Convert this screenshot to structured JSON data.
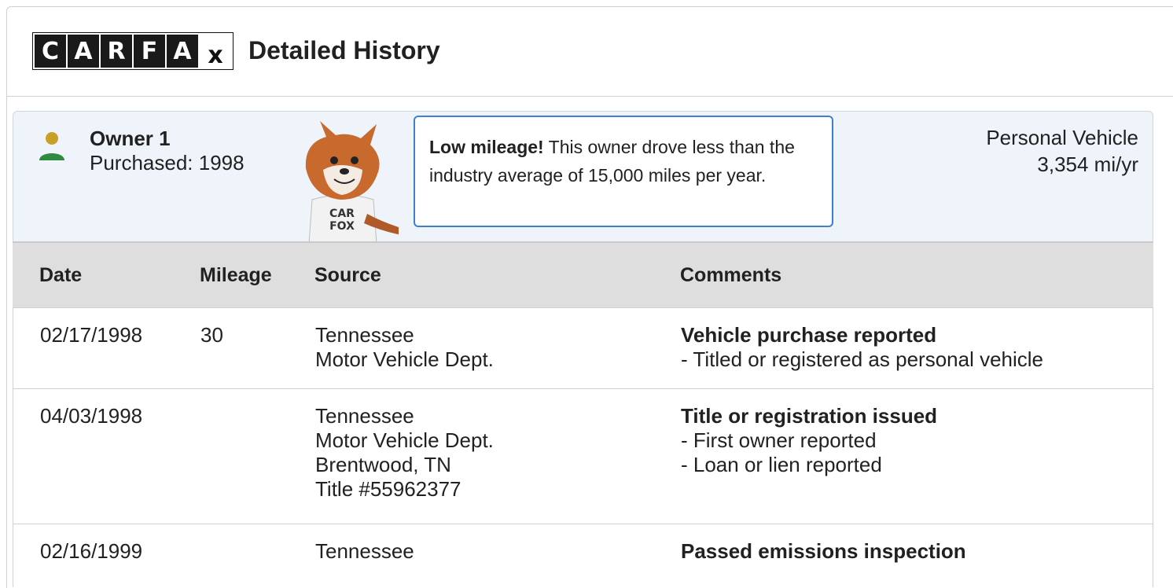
{
  "header": {
    "logo_letters": [
      "C",
      "A",
      "R",
      "F",
      "A",
      "x"
    ],
    "title": "Detailed History"
  },
  "owner": {
    "name": "Owner 1",
    "purchased": "Purchased: 1998",
    "fox_shirt_text": [
      "CAR",
      "FOX"
    ],
    "callout_bold": "Low mileage!",
    "callout_text": " This owner drove less than the industry average of 15,000 miles per year.",
    "usage_type": "Personal Vehicle",
    "usage_rate": "3,354 mi/yr"
  },
  "table": {
    "columns": {
      "date": "Date",
      "mileage": "Mileage",
      "source": "Source",
      "comments": "Comments"
    },
    "rows": [
      {
        "date": "02/17/1998",
        "mileage": "30",
        "source": [
          "Tennessee",
          "Motor Vehicle Dept."
        ],
        "comment_title": "Vehicle purchase reported",
        "comment_lines": [
          "- Titled or registered as personal vehicle"
        ]
      },
      {
        "date": "04/03/1998",
        "mileage": "",
        "source": [
          "Tennessee",
          "Motor Vehicle Dept.",
          "Brentwood, TN",
          "Title #55962377"
        ],
        "comment_title": "Title or registration issued",
        "comment_lines": [
          "- First owner reported",
          "- Loan or lien reported"
        ]
      },
      {
        "date": "02/16/1999",
        "mileage": "",
        "source": [
          "Tennessee"
        ],
        "comment_title": "Passed emissions inspection",
        "comment_lines": []
      }
    ]
  },
  "colors": {
    "owner_box_bg": "#eef4fa",
    "callout_border": "#3f7fd1",
    "person_head": "#c8a023",
    "person_body": "#2e8b3f",
    "table_header_bg": "#dedede"
  }
}
